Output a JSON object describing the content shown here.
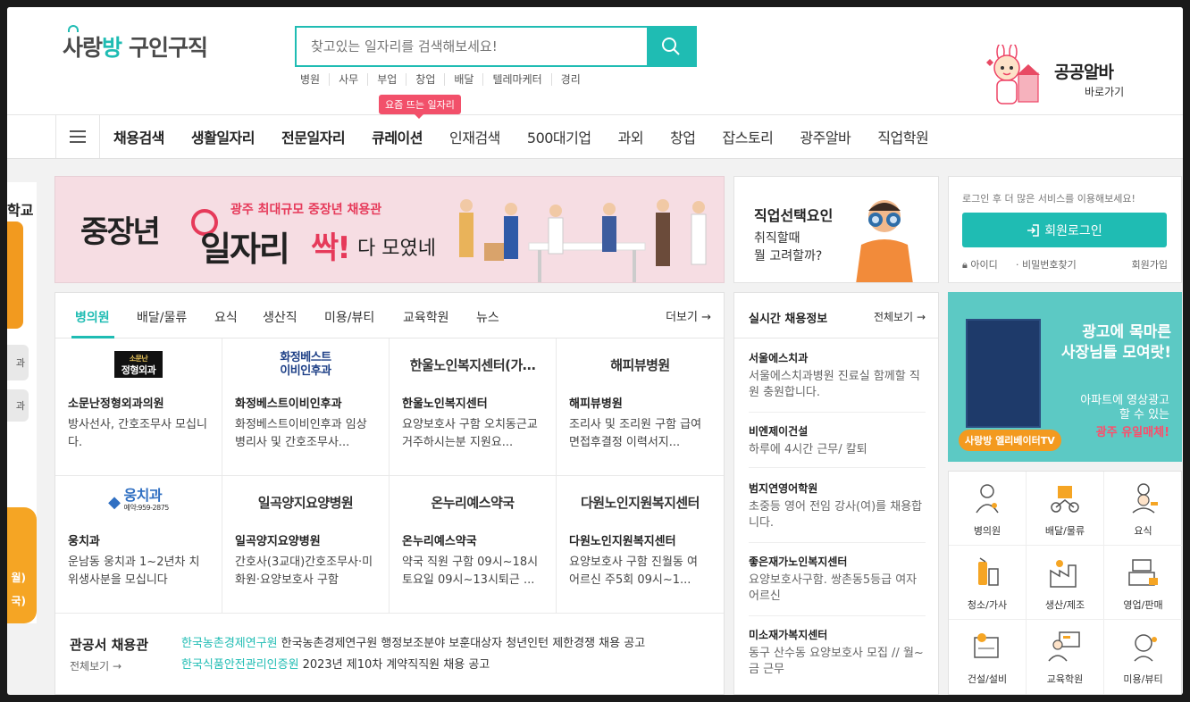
{
  "header": {
    "logo_part1": "사랑",
    "logo_part2": "방",
    "logo_part3": "구인구직",
    "search_placeholder": "찾고있는 일자리를 검색해보세요!",
    "quick_links": [
      "병원",
      "사무",
      "부업",
      "창업",
      "배달",
      "텔레마케터",
      "경리"
    ],
    "public_title": "공공알바",
    "public_sub": "바로가기"
  },
  "nav": {
    "badge": "요즘 뜨는 일자리",
    "items": [
      "채용검색",
      "생활일자리",
      "전문일자리",
      "큐레이션",
      "인재검색",
      "500대기업",
      "과외",
      "창업",
      "잡스토리",
      "광주알바",
      "직업학원"
    ]
  },
  "side_ad": {
    "text_top": "학교",
    "btn1": "과",
    "btn2": "과",
    "bottom1": "월)",
    "bottom2": "국)"
  },
  "banner": {
    "sub": "광주 최대규모 중장년 채용관",
    "w1": "중장년",
    "w2": "일자리",
    "w3": "싹!",
    "w4": "다 모였네"
  },
  "side_card": {
    "title": "직업선택요인",
    "line1": "취직할때",
    "line2": "뭘 고려할까?"
  },
  "login": {
    "hint": "로그인 후 더 많은 서비스를 이용해보세요!",
    "button": "회원로그인",
    "id_link": "아이디",
    "pw_link": "비밀번호찾기",
    "join": "회원가입"
  },
  "jobs": {
    "tabs": [
      "병의원",
      "배달/물류",
      "요식",
      "생산직",
      "미용/뷰티",
      "교육학원",
      "뉴스"
    ],
    "more": "더보기",
    "cards": [
      {
        "logo": "소문난 정형외과",
        "name": "소문난정형외과의원",
        "desc": "방사선사, 간호조무사 모십니다."
      },
      {
        "logo": "화정베스트 이비인후과",
        "name": "화정베스트이비인후과",
        "desc": "화정베스트이비인후과 임상병리사 및 간호조무사..."
      },
      {
        "logo": "한울노인복지센터(가…",
        "name": "한울노인복지센터",
        "desc": "요양보호사 구함 오치동근교거주하시는분 지원요..."
      },
      {
        "logo": "해피뷰병원",
        "name": "해피뷰병원",
        "desc": "조리사 및 조리원 구함 급여면접후결정 이력서지..."
      },
      {
        "logo": "웅치과",
        "name": "웅치과",
        "desc": "운남동 웅치과 1~2년차 치위생사분을 모십니다"
      },
      {
        "logo": "일곡양지요양병원",
        "name": "일곡양지요양병원",
        "desc": "간호사(3교대)간호조무사·미화원·요양보호사 구함"
      },
      {
        "logo": "온누리예스약국",
        "name": "온누리예스약국",
        "desc": "약국 직원 구함 09시~18시 토요일 09시~13시퇴근 ..."
      },
      {
        "logo": "다원노인지원복지센터",
        "name": "다원노인지원복지센터",
        "desc": "요양보호사 구함 진월동 여 어르신 주5회 09시~1..."
      }
    ],
    "logo_extra": {
      "clinic_tag": "소문난",
      "clinic_name": "정형외과",
      "dental_tel": "예약:959-2875",
      "bestent_1": "화정베스트",
      "bestent_2": "이비인후과"
    }
  },
  "gov": {
    "title": "관공서 채용관",
    "all": "전체보기",
    "rows": [
      {
        "org": "한국농촌경제연구원",
        "title": "한국농촌경제연구원 행정보조분야 보훈대상자 청년인턴 제한경쟁 채용 공고"
      },
      {
        "org": "한국식품안전관리인증원",
        "title": "2023년 제10차 계약직직원 채용 공고"
      }
    ]
  },
  "realtime": {
    "title": "실시간 채용정보",
    "all": "전체보기",
    "items": [
      {
        "name": "서울에스치과",
        "desc": "서울에스치과병원 진료실 함께할 직원 충원합니다."
      },
      {
        "name": "비엔제이건설",
        "desc": "하루에 4시간 근무/ 칼퇴"
      },
      {
        "name": "범지연영어학원",
        "desc": "초중등 영어 전임 강사(여)를 채용합니다."
      },
      {
        "name": "좋은재가노인복지센터",
        "desc": "요양보호사구함. 쌍촌동5등급 여자어르신"
      },
      {
        "name": "미소재가복지센터",
        "desc": "동구 산수동 요양보호사 모집 // 월~금 근무"
      }
    ]
  },
  "tv_ad": {
    "head1": "광고에 목마른",
    "head2": "사장님들 모여랏!",
    "line1": "아파트에 영상광고",
    "line2": "할 수 있는",
    "highlight": "광주 유일매체!",
    "chip": "사랑방 엘리베이터TV"
  },
  "categories": [
    "병의원",
    "배달/물류",
    "요식",
    "청소/가사",
    "생산/제조",
    "영업/판매",
    "건설/설비",
    "교육학원",
    "미용/뷰티"
  ],
  "colors": {
    "accent": "#1fbcb3",
    "badge": "#f2506a",
    "banner_bg": "#f6dde3",
    "highlight": "#e63a5a"
  }
}
